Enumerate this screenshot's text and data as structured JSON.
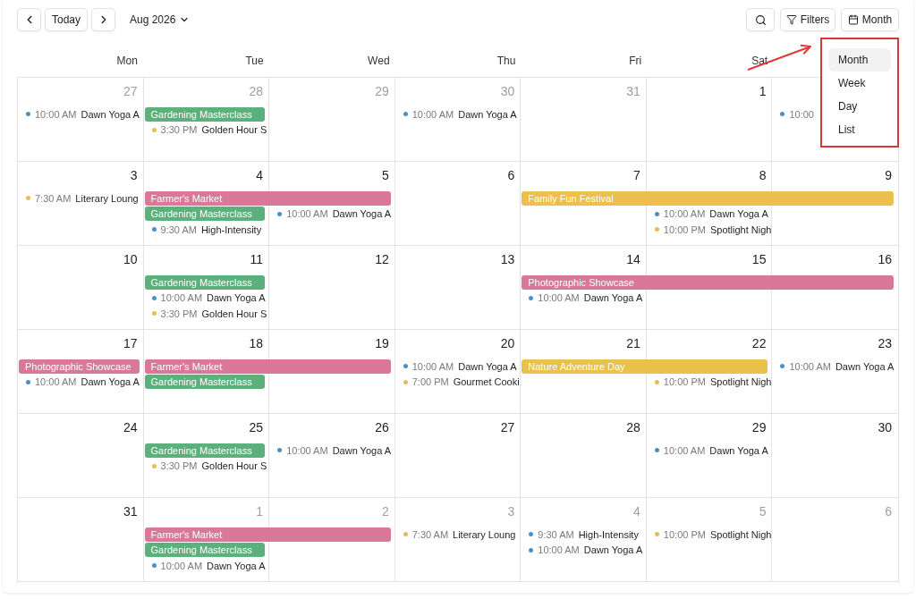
{
  "toolbar": {
    "today_button": "Today",
    "period": "Aug 2026",
    "filters_button": "Filters",
    "view_button": "Month"
  },
  "weekdays": [
    "Mon",
    "Tue",
    "Wed",
    "Thu",
    "Fri",
    "Sat"
  ],
  "weeks": [
    {
      "days": [
        {
          "date": "27",
          "outside": true,
          "events": [
            {
              "kind": "timed",
              "time": "10:00 AM",
              "title": "Dawn Yoga A",
              "color": "#4a90c8"
            }
          ]
        },
        {
          "date": "28",
          "outside": true,
          "events": [
            {
              "kind": "bar",
              "title": "Gardening Masterclass",
              "color": "#5cb07c"
            },
            {
              "kind": "timed",
              "time": "3:30 PM",
              "title": "Golden Hour S",
              "color": "#e3bf55"
            }
          ]
        },
        {
          "date": "29",
          "outside": true
        },
        {
          "date": "30",
          "outside": true,
          "events": [
            {
              "kind": "timed",
              "time": "10:00 AM",
              "title": "Dawn Yoga A",
              "color": "#4a90c8"
            }
          ]
        },
        {
          "date": "31",
          "outside": true
        },
        {
          "date": "1",
          "outside": false
        },
        {
          "events": [
            {
              "kind": "timed",
              "time": "10:00",
              "color": "#4a90c8"
            }
          ]
        }
      ]
    },
    {
      "days": [
        {
          "date": "3",
          "outside": false,
          "events": [
            {
              "kind": "timed",
              "time": "7:30 AM",
              "title": "Literary Loung",
              "color": "#e3bf55"
            }
          ]
        },
        {
          "date": "4",
          "outside": false,
          "events": [
            {
              "kind": "bar",
              "title": "Farmer's Market",
              "color": "#d97898"
            },
            {
              "kind": "bar",
              "title": "Gardening Masterclass",
              "color": "#5cb07c"
            },
            {
              "kind": "timed",
              "time": "9:30 AM",
              "title": "High-Intensity",
              "color": "#4a90c8"
            }
          ]
        },
        {
          "date": "5",
          "outside": false,
          "events": [
            {
              "kind": "continued"
            },
            {
              "kind": "timed",
              "time": "10:00 AM",
              "title": "Dawn Yoga A",
              "color": "#4a90c8"
            }
          ]
        },
        {
          "date": "6",
          "outside": false
        },
        {
          "date": "7",
          "outside": false,
          "events": [
            {
              "kind": "bar",
              "title": "Family Fun Festival",
              "color": "#ecc04c"
            }
          ]
        },
        {
          "date": "8",
          "outside": false,
          "events": [
            {
              "kind": "continued"
            },
            {
              "kind": "timed",
              "time": "10:00 AM",
              "title": "Dawn Yoga A",
              "color": "#4a90c8"
            },
            {
              "kind": "timed",
              "time": "10:00 PM",
              "title": "Spotlight Nigh",
              "color": "#e3bf55"
            }
          ]
        },
        {
          "date": "9",
          "outside": false,
          "events": [
            {
              "kind": "continued"
            }
          ]
        }
      ]
    },
    {
      "days": [
        {
          "date": "10",
          "outside": false
        },
        {
          "date": "11",
          "outside": false,
          "events": [
            {
              "kind": "bar",
              "title": "Gardening Masterclass",
              "color": "#5cb07c"
            },
            {
              "kind": "timed",
              "time": "10:00 AM",
              "title": "Dawn Yoga A",
              "color": "#4a90c8"
            },
            {
              "kind": "timed",
              "time": "3:30 PM",
              "title": "Golden Hour S",
              "color": "#e3bf55"
            }
          ]
        },
        {
          "date": "12",
          "outside": false
        },
        {
          "date": "13",
          "outside": false
        },
        {
          "date": "14",
          "outside": false,
          "events": [
            {
              "kind": "bar",
              "title": "Photographic Showcase",
              "color": "#d97898"
            },
            {
              "kind": "timed",
              "time": "10:00 AM",
              "title": "Dawn Yoga A",
              "color": "#4a90c8"
            }
          ]
        },
        {
          "date": "15",
          "outside": false,
          "events": [
            {
              "kind": "continued"
            }
          ]
        },
        {
          "date": "16",
          "outside": false,
          "events": [
            {
              "kind": "continued"
            }
          ]
        }
      ]
    },
    {
      "days": [
        {
          "date": "17",
          "outside": false,
          "events": [
            {
              "kind": "bar",
              "title": "Photographic Showcase",
              "color": "#d97898"
            },
            {
              "kind": "timed",
              "time": "10:00 AM",
              "title": "Dawn Yoga A",
              "color": "#4a90c8"
            }
          ]
        },
        {
          "date": "18",
          "outside": false,
          "events": [
            {
              "kind": "bar",
              "title": "Farmer's Market",
              "color": "#d97898"
            },
            {
              "kind": "bar",
              "title": "Gardening Masterclass",
              "color": "#5cb07c"
            }
          ]
        },
        {
          "date": "19",
          "outside": false,
          "events": [
            {
              "kind": "continued"
            }
          ]
        },
        {
          "date": "20",
          "outside": false,
          "events": [
            {
              "kind": "timed",
              "time": "10:00 AM",
              "title": "Dawn Yoga A",
              "color": "#4a90c8"
            },
            {
              "kind": "timed",
              "time": "7:00 PM",
              "title": "Gourmet Cooki",
              "color": "#e3bf55"
            }
          ]
        },
        {
          "date": "21",
          "outside": false,
          "events": [
            {
              "kind": "bar",
              "title": "Nature Adventure Day",
              "color": "#ecc04c"
            }
          ]
        },
        {
          "date": "22",
          "outside": false,
          "events": [
            {
              "kind": "continued"
            },
            {
              "kind": "timed",
              "time": "10:00 PM",
              "title": "Spotlight Nigh",
              "color": "#e3bf55"
            }
          ]
        },
        {
          "date": "23",
          "outside": false,
          "events": [
            {
              "kind": "timed",
              "time": "10:00 AM",
              "title": "Dawn Yoga A",
              "color": "#4a90c8"
            }
          ]
        }
      ]
    },
    {
      "days": [
        {
          "date": "24",
          "outside": false
        },
        {
          "date": "25",
          "outside": false,
          "events": [
            {
              "kind": "bar",
              "title": "Gardening Masterclass",
              "color": "#5cb07c"
            },
            {
              "kind": "timed",
              "time": "3:30 PM",
              "title": "Golden Hour S",
              "color": "#e3bf55"
            }
          ]
        },
        {
          "date": "26",
          "outside": false,
          "events": [
            {
              "kind": "timed",
              "time": "10:00 AM",
              "title": "Dawn Yoga A",
              "color": "#4a90c8"
            }
          ]
        },
        {
          "date": "27",
          "outside": false
        },
        {
          "date": "28",
          "outside": false
        },
        {
          "date": "29",
          "outside": false,
          "events": [
            {
              "kind": "timed",
              "time": "10:00 AM",
              "title": "Dawn Yoga A",
              "color": "#4a90c8"
            }
          ]
        },
        {
          "date": "30",
          "outside": false
        }
      ]
    },
    {
      "days": [
        {
          "date": "31",
          "outside": false
        },
        {
          "date": "1",
          "outside": true,
          "events": [
            {
              "kind": "bar",
              "title": "Farmer's Market",
              "color": "#d97898"
            },
            {
              "kind": "bar",
              "title": "Gardening Masterclass",
              "color": "#5cb07c"
            },
            {
              "kind": "timed",
              "time": "10:00 AM",
              "title": "Dawn Yoga A",
              "color": "#4a90c8"
            }
          ]
        },
        {
          "date": "2",
          "outside": true,
          "events": [
            {
              "kind": "continued"
            }
          ]
        },
        {
          "date": "3",
          "outside": true,
          "events": [
            {
              "kind": "timed",
              "time": "7:30 AM",
              "title": "Literary Loung",
              "color": "#e3bf55"
            }
          ]
        },
        {
          "date": "4",
          "outside": true,
          "events": [
            {
              "kind": "timed",
              "time": "9:30 AM",
              "title": "High-Intensity",
              "color": "#4a90c8"
            },
            {
              "kind": "timed",
              "time": "10:00 AM",
              "title": "Dawn Yoga A",
              "color": "#4a90c8"
            }
          ]
        },
        {
          "date": "5",
          "outside": true,
          "events": [
            {
              "kind": "timed",
              "time": "10:00 PM",
              "title": "Spotlight Nigh",
              "color": "#e3bf55"
            }
          ]
        },
        {
          "date": "6",
          "outside": true
        }
      ]
    }
  ],
  "view_menu": [
    {
      "label": "Month",
      "selected": true
    },
    {
      "label": "Week",
      "selected": false
    },
    {
      "label": "Day",
      "selected": false
    },
    {
      "label": "List",
      "selected": false
    }
  ]
}
